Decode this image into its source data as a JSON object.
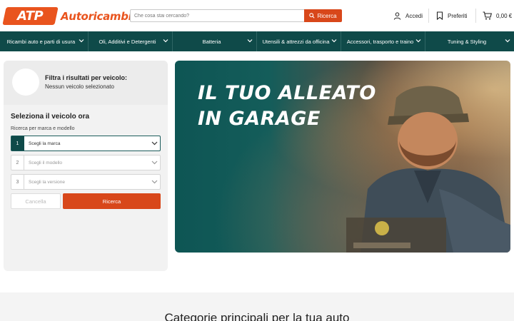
{
  "brand": {
    "badge": "ATP",
    "name": "Autoricambi",
    "accent": "#e9541e"
  },
  "search": {
    "placeholder": "Che cosa stai cercando?",
    "button_label": "Ricerca"
  },
  "header_actions": {
    "login": "Accedi",
    "favorites": "Preferiti",
    "cart_total": "0,00 €"
  },
  "nav": {
    "background": "#0f4a49",
    "items": [
      {
        "label": "Ricambi auto e parti di usura"
      },
      {
        "label": "Oli, Additivi e Detergenti"
      },
      {
        "label": "Batteria"
      },
      {
        "label": "Utensili & attrezzi da officina"
      },
      {
        "label": "Accessori, trasporto e traino"
      },
      {
        "label": "Tuning & Styling"
      }
    ]
  },
  "vehicle_filter": {
    "title": "Filtra i risultati per veicolo:",
    "status": "Nessun veicolo selezionato",
    "select_heading": "Seleziona il veicolo ora",
    "select_label": "Ricerca per marca e modello",
    "steps": [
      {
        "number": "1",
        "placeholder": "Scegli la marca"
      },
      {
        "number": "2",
        "placeholder": "Scegli il modello"
      },
      {
        "number": "3",
        "placeholder": "Scegli la versione"
      }
    ],
    "cancel_label": "Cancella",
    "search_label": "Ricerca"
  },
  "hero": {
    "line1": "IL TUO ALLEATO",
    "line2": "IN GARAGE"
  },
  "section": {
    "title": "Categorie principali per la tua auto"
  }
}
